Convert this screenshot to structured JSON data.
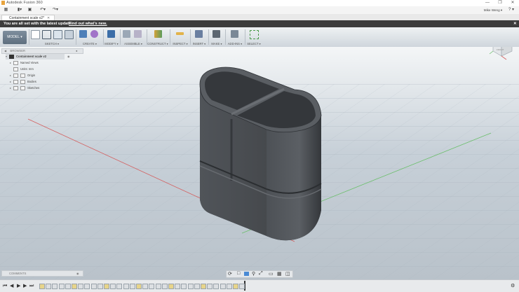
{
  "titlebar": {
    "title": "Autodesk Fusion 360"
  },
  "user_menu": {
    "label": "Mike Weng ▾"
  },
  "help_label": "? ▾",
  "document_tab": {
    "label": "Containment scale v2*"
  },
  "banner": {
    "message": "You are all set with the latest update.",
    "link": "Find out what's new."
  },
  "workspace": {
    "label": "MODEL ▾"
  },
  "toolbar": {
    "groups": [
      {
        "label": "SKETCH ▾"
      },
      {
        "label": "CREATE ▾"
      },
      {
        "label": "MODIFY ▾"
      },
      {
        "label": "ASSEMBLE ▾"
      },
      {
        "label": "CONSTRUCT ▾"
      },
      {
        "label": "INSPECT ▾"
      },
      {
        "label": "INSERT ▾"
      },
      {
        "label": "MAKE ▾"
      },
      {
        "label": "ADD-INS ▾"
      },
      {
        "label": "SELECT ▾"
      }
    ]
  },
  "browser": {
    "title": "BROWSER",
    "root": "Containment scale v2",
    "nodes": [
      "Named Views",
      "Units: mm",
      "Origin",
      "Bodies",
      "Sketches"
    ]
  },
  "comments": {
    "title": "COMMENTS"
  },
  "viewcube": {
    "label": "FRONT"
  },
  "colors": {
    "banner": "#3c3c3c",
    "model": "#3f4347",
    "accent": "#e8a33d",
    "grid_axis_red": "#d46060",
    "grid_axis_green": "#6bbf6b"
  },
  "icons": [
    "grid-icon",
    "file-icon",
    "save-icon",
    "undo-icon",
    "redo-icon",
    "close-icon",
    "orbit-icon",
    "pan-icon",
    "zoom-icon",
    "display-icon",
    "play-icon",
    "settings-icon"
  ]
}
